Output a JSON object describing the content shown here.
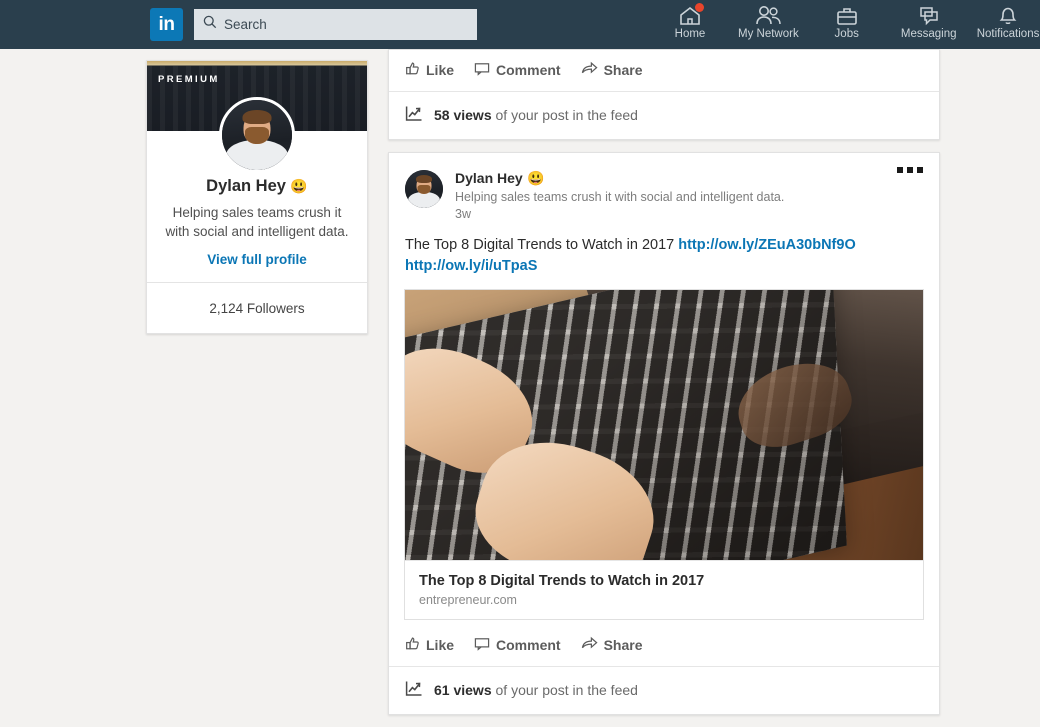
{
  "nav": {
    "logo_text": "in",
    "search_placeholder": "Search",
    "search_value": "",
    "items": [
      {
        "label": "Home",
        "icon": "home-icon",
        "badge": true
      },
      {
        "label": "My Network",
        "icon": "people-icon",
        "badge": false
      },
      {
        "label": "Jobs",
        "icon": "briefcase-icon",
        "badge": false
      },
      {
        "label": "Messaging",
        "icon": "message-icon",
        "badge": false
      },
      {
        "label": "Notifications",
        "icon": "bell-icon",
        "badge": false
      }
    ]
  },
  "profile_card": {
    "premium_label": "PREMIUM",
    "name": "Dylan Hey",
    "name_emoji": "😃",
    "headline": "Helping sales teams crush it with social and intelligent data.",
    "view_profile_label": "View full profile",
    "followers": "2,124 Followers"
  },
  "feed": {
    "top_post": {
      "actions": [
        {
          "label": "Like",
          "icon": "thumbs-up-icon"
        },
        {
          "label": "Comment",
          "icon": "comment-icon"
        },
        {
          "label": "Share",
          "icon": "share-icon"
        }
      ],
      "views_count": "58 views",
      "views_suffix": " of your post in the feed",
      "views_icon": "analytics-icon"
    },
    "post": {
      "author_name": "Dylan Hey",
      "author_emoji": "😃",
      "author_headline": "Helping sales teams crush it with social and intelligent data.",
      "timestamp": "3w",
      "menu_icon": "more-options-icon",
      "body_text": "The Top 8 Digital Trends to Watch in 2017 ",
      "link_1": "http://ow.ly/ZEuA30bNf9O",
      "link_2": "http://ow.ly/i/uTpaS",
      "article": {
        "image_alt": "hands-typing-on-laptop-photo",
        "title": "The Top 8 Digital Trends to Watch in 2017",
        "source": "entrepreneur.com"
      },
      "actions": [
        {
          "label": "Like",
          "icon": "thumbs-up-icon"
        },
        {
          "label": "Comment",
          "icon": "comment-icon"
        },
        {
          "label": "Share",
          "icon": "share-icon"
        }
      ],
      "views_count": "61 views",
      "views_suffix": " of your post in the feed",
      "views_icon": "analytics-icon"
    }
  },
  "colors": {
    "nav_background": "#2a3f4d",
    "brand_blue": "#0c78b6",
    "link_blue": "#0b76b5",
    "page_background": "#f3f2f0",
    "badge_red": "#e8452c",
    "premium_gold": "#c9ab6a"
  }
}
